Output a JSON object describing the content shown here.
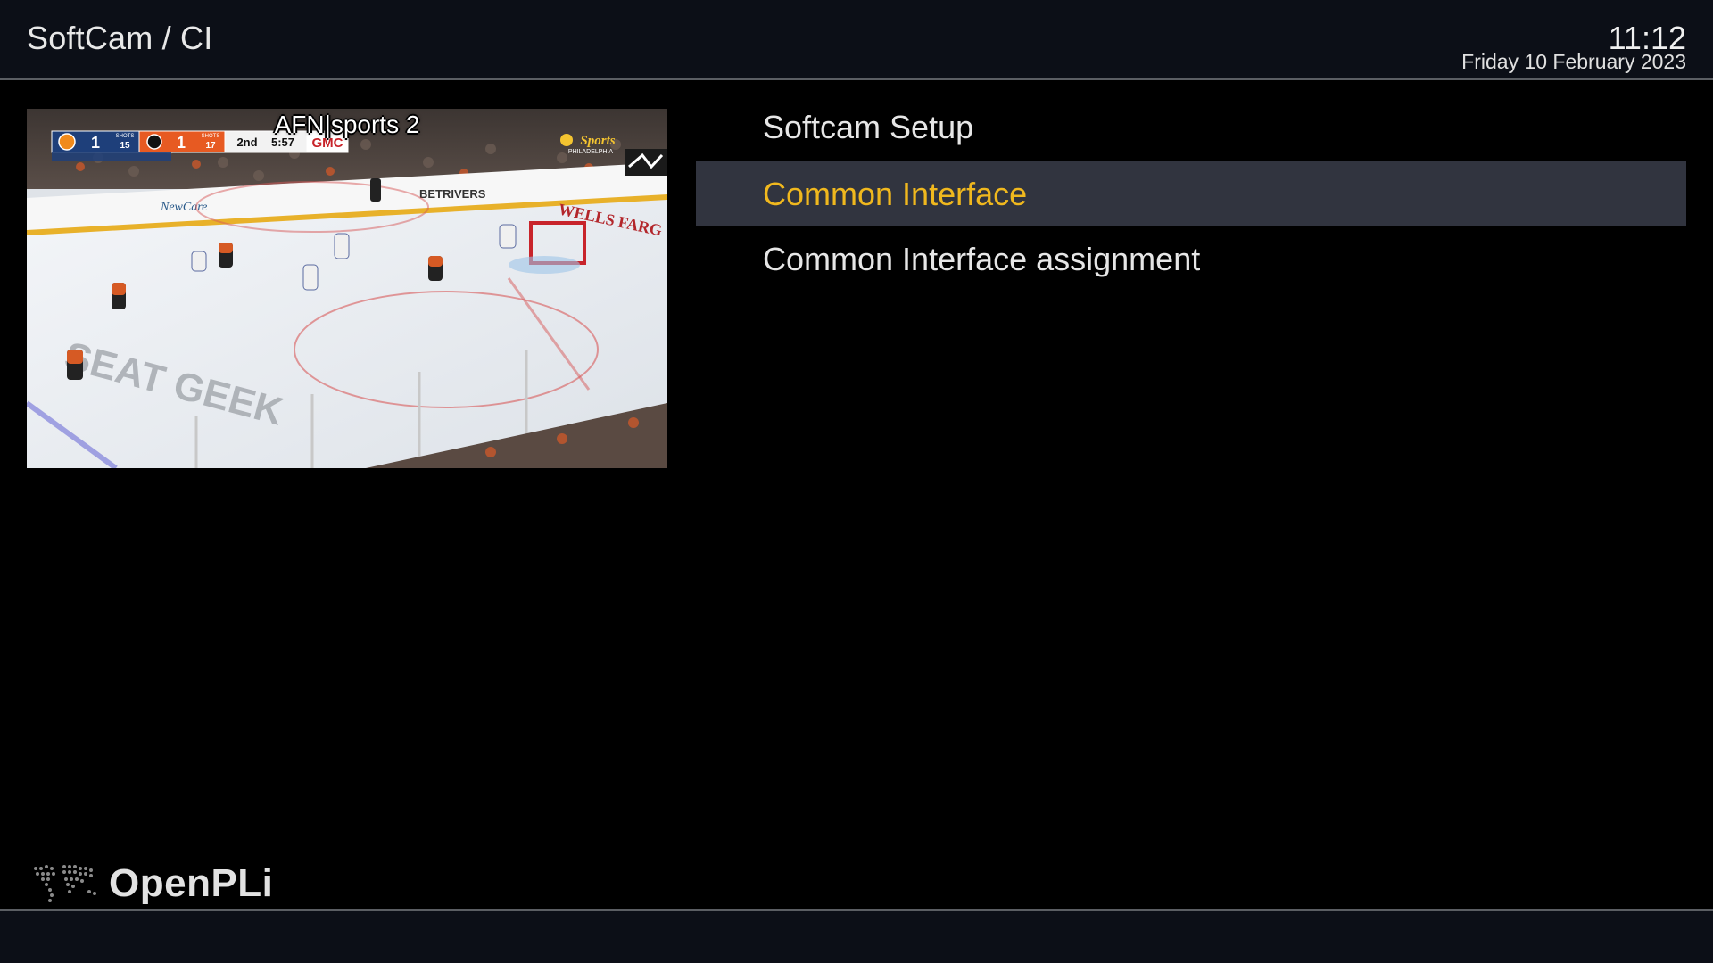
{
  "header": {
    "title": "SoftCam / CI",
    "time": "11:12",
    "date": "Friday 10 February 2023"
  },
  "preview": {
    "channel": "AFN|sports 2",
    "scoreboard": {
      "team1_score": "1",
      "team1_shots_label": "SHOTS",
      "team1_shots": "15",
      "team2_score": "1",
      "team2_shots_label": "SHOTS",
      "team2_shots": "17",
      "period": "2nd",
      "clock": "5:57",
      "sponsor": "GMC"
    },
    "boards": [
      "NewCare",
      "BETRIVERS",
      "WELLS FARG"
    ],
    "network_logo": "Sports",
    "network_sub": "PHILADELPHIA",
    "ice_logo": "SEAT GEEK"
  },
  "menu": {
    "items": [
      {
        "label": "Softcam Setup",
        "selected": false
      },
      {
        "label": "Common Interface",
        "selected": true
      },
      {
        "label": "Common Interface assignment",
        "selected": false
      }
    ]
  },
  "footer": {
    "logo_text": "OpenPLi"
  },
  "colors": {
    "selected_text": "#f0b81e",
    "selected_bg": "#31343f",
    "header_bg": "#0c0f17",
    "normal_text": "#e6e6e6"
  }
}
